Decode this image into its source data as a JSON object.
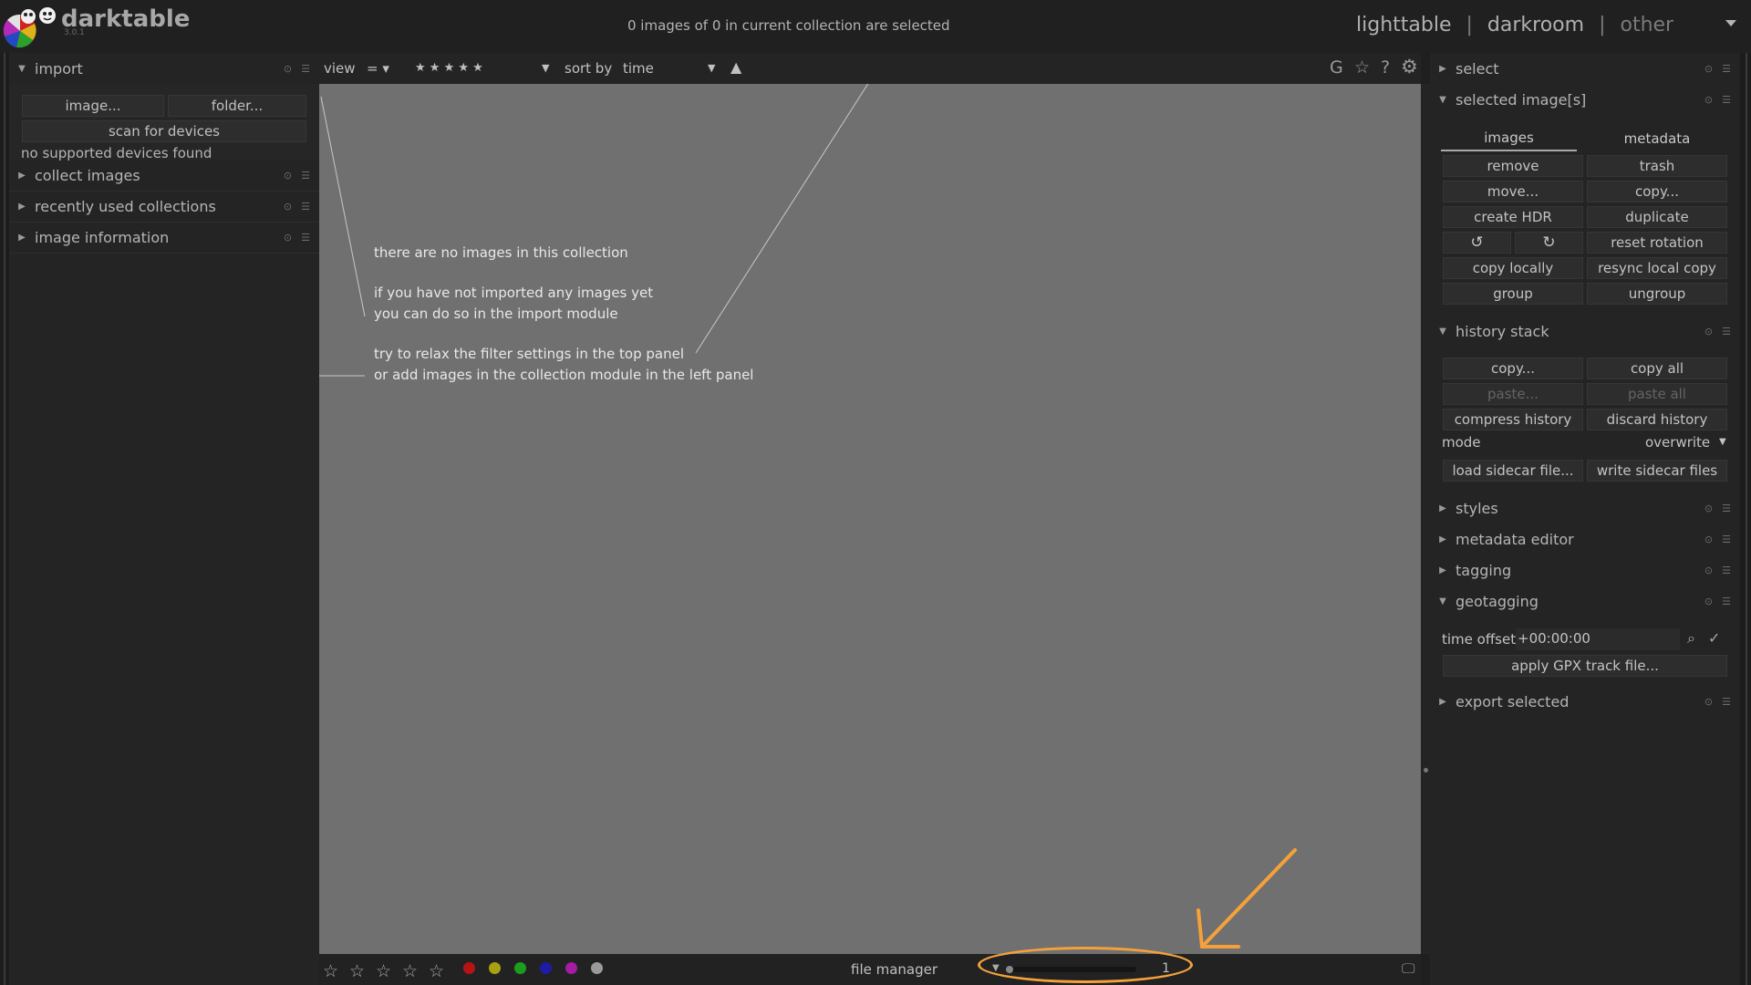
{
  "app": {
    "name": "darktable",
    "version": "3.0.1"
  },
  "header": {
    "selection_status": "0 images of 0 in current collection are selected",
    "views": {
      "lighttable": "lighttable",
      "darkroom": "darkroom",
      "other": "other",
      "separator": "|"
    }
  },
  "left_panel": {
    "import": {
      "title": "import",
      "image_button": "image...",
      "folder_button": "folder...",
      "scan_button": "scan for devices",
      "devices_status": "no supported devices found"
    },
    "modules": [
      "collect images",
      "recently used collections",
      "image information"
    ]
  },
  "top_toolbar": {
    "view_label": "view",
    "comparator": "=",
    "rating_filter": "★ ★ ★ ★ ★",
    "sort_label": "sort by",
    "sort_value": "time",
    "icons": [
      "grouping-icon",
      "star-overlay-icon",
      "help-icon",
      "gear-icon"
    ],
    "grouping_glyph": "G",
    "star_glyph": "☆",
    "help_glyph": "?",
    "gear_glyph": "⚙"
  },
  "center": {
    "messages": [
      "there are no images in this collection",
      "if you have not imported any images yet",
      "you can do so in the import module",
      "try to relax the filter settings in the top panel",
      "or add images in the collection module in the left panel"
    ]
  },
  "bottom_bar": {
    "stars": [
      "☆",
      "☆",
      "☆",
      "☆",
      "☆"
    ],
    "color_labels": [
      "#b51414",
      "#a9a012",
      "#1c9e1c",
      "#1c1ca4",
      "#a31ca3",
      "#9a9a9a"
    ],
    "layout_label": "file manager",
    "zoom_value": "1"
  },
  "right_panel": {
    "select_title": "select",
    "selected_images": {
      "title": "selected image[s]",
      "tabs": [
        "images",
        "metadata"
      ],
      "buttons": [
        "remove",
        "trash",
        "move...",
        "copy...",
        "create HDR",
        "duplicate",
        "reset rotation",
        "copy locally",
        "resync local copy",
        "group",
        "ungroup"
      ],
      "rotate_ccw_glyph": "↺",
      "rotate_cw_glyph": "↻"
    },
    "history_stack": {
      "title": "history stack",
      "copy": "copy...",
      "copy_all": "copy all",
      "paste": "paste...",
      "paste_all": "paste all",
      "compress": "compress history",
      "discard": "discard history",
      "mode_label": "mode",
      "mode_value": "overwrite",
      "load_sidecar": "load sidecar file...",
      "write_sidecar": "write sidecar files"
    },
    "collapsed": [
      "styles",
      "metadata editor",
      "tagging"
    ],
    "geotagging": {
      "title": "geotagging",
      "time_offset_label": "time offset",
      "time_offset_value": "+00:00:00",
      "apply_gpx": "apply GPX track file..."
    },
    "export_title": "export selected"
  },
  "annotation": {
    "color": "#f5a13b"
  }
}
